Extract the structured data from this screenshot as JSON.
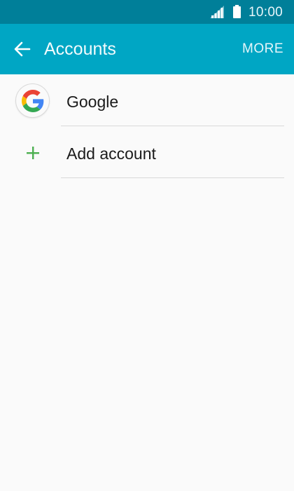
{
  "status_bar": {
    "time": "10:00",
    "signal_icon": "signal-icon",
    "battery_icon": "battery-icon"
  },
  "app_bar": {
    "title": "Accounts",
    "more_label": "MORE",
    "back_icon": "arrow-left-icon"
  },
  "accounts": {
    "items": [
      {
        "label": "Google",
        "icon": "google-logo-icon"
      },
      {
        "label": "Add account",
        "icon": "plus-icon"
      }
    ]
  },
  "colors": {
    "status_bar_bg": "#007f99",
    "app_bar_bg": "#00a6c4",
    "page_bg": "#fafafa",
    "plus_green": "#4caf50"
  }
}
